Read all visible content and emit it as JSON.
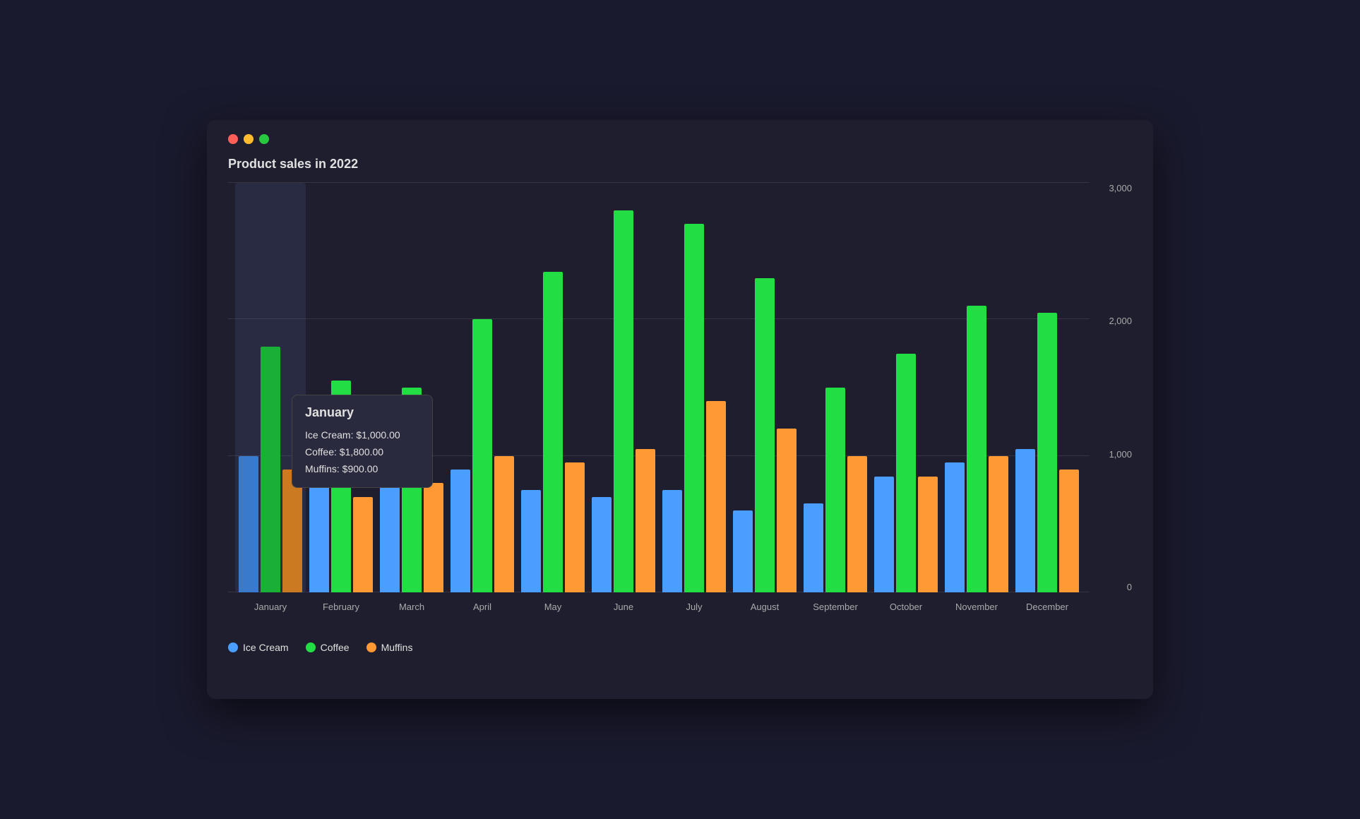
{
  "window": {
    "title": "Product sales in 2022"
  },
  "chart": {
    "title": "Product sales in 2022",
    "y_axis": {
      "max": 3000,
      "labels": [
        "3,000",
        "2,000",
        "1,000",
        "0"
      ]
    },
    "months": [
      "January",
      "February",
      "March",
      "April",
      "May",
      "June",
      "July",
      "August",
      "September",
      "October",
      "November",
      "December"
    ],
    "series": {
      "ice_cream": {
        "label": "Ice Cream",
        "color": "#4a9eff",
        "values": [
          1000,
          1050,
          850,
          900,
          750,
          700,
          750,
          600,
          650,
          850,
          950,
          1050
        ]
      },
      "coffee": {
        "label": "Coffee",
        "color": "#22dd44",
        "values": [
          1800,
          1550,
          1500,
          2000,
          2350,
          2800,
          2700,
          2300,
          1500,
          1750,
          2100,
          2050
        ]
      },
      "muffins": {
        "label": "Muffins",
        "color": "#ff9933",
        "values": [
          900,
          700,
          800,
          1000,
          950,
          1050,
          1400,
          1200,
          1000,
          850,
          1000,
          900
        ]
      }
    },
    "tooltip": {
      "month": "January",
      "ice_cream_label": "Ice Cream",
      "ice_cream_value": "$1,000.00",
      "coffee_label": "Coffee",
      "coffee_value": "$1,800.00",
      "muffins_label": "Muffins",
      "muffins_value": "$900.00"
    }
  },
  "legend": {
    "items": [
      {
        "label": "Ice Cream",
        "color": "#4a9eff"
      },
      {
        "label": "Coffee",
        "color": "#22dd44"
      },
      {
        "label": "Muffins",
        "color": "#ff9933"
      }
    ]
  },
  "traffic_lights": {
    "close": "close-icon",
    "minimize": "minimize-icon",
    "maximize": "maximize-icon"
  }
}
